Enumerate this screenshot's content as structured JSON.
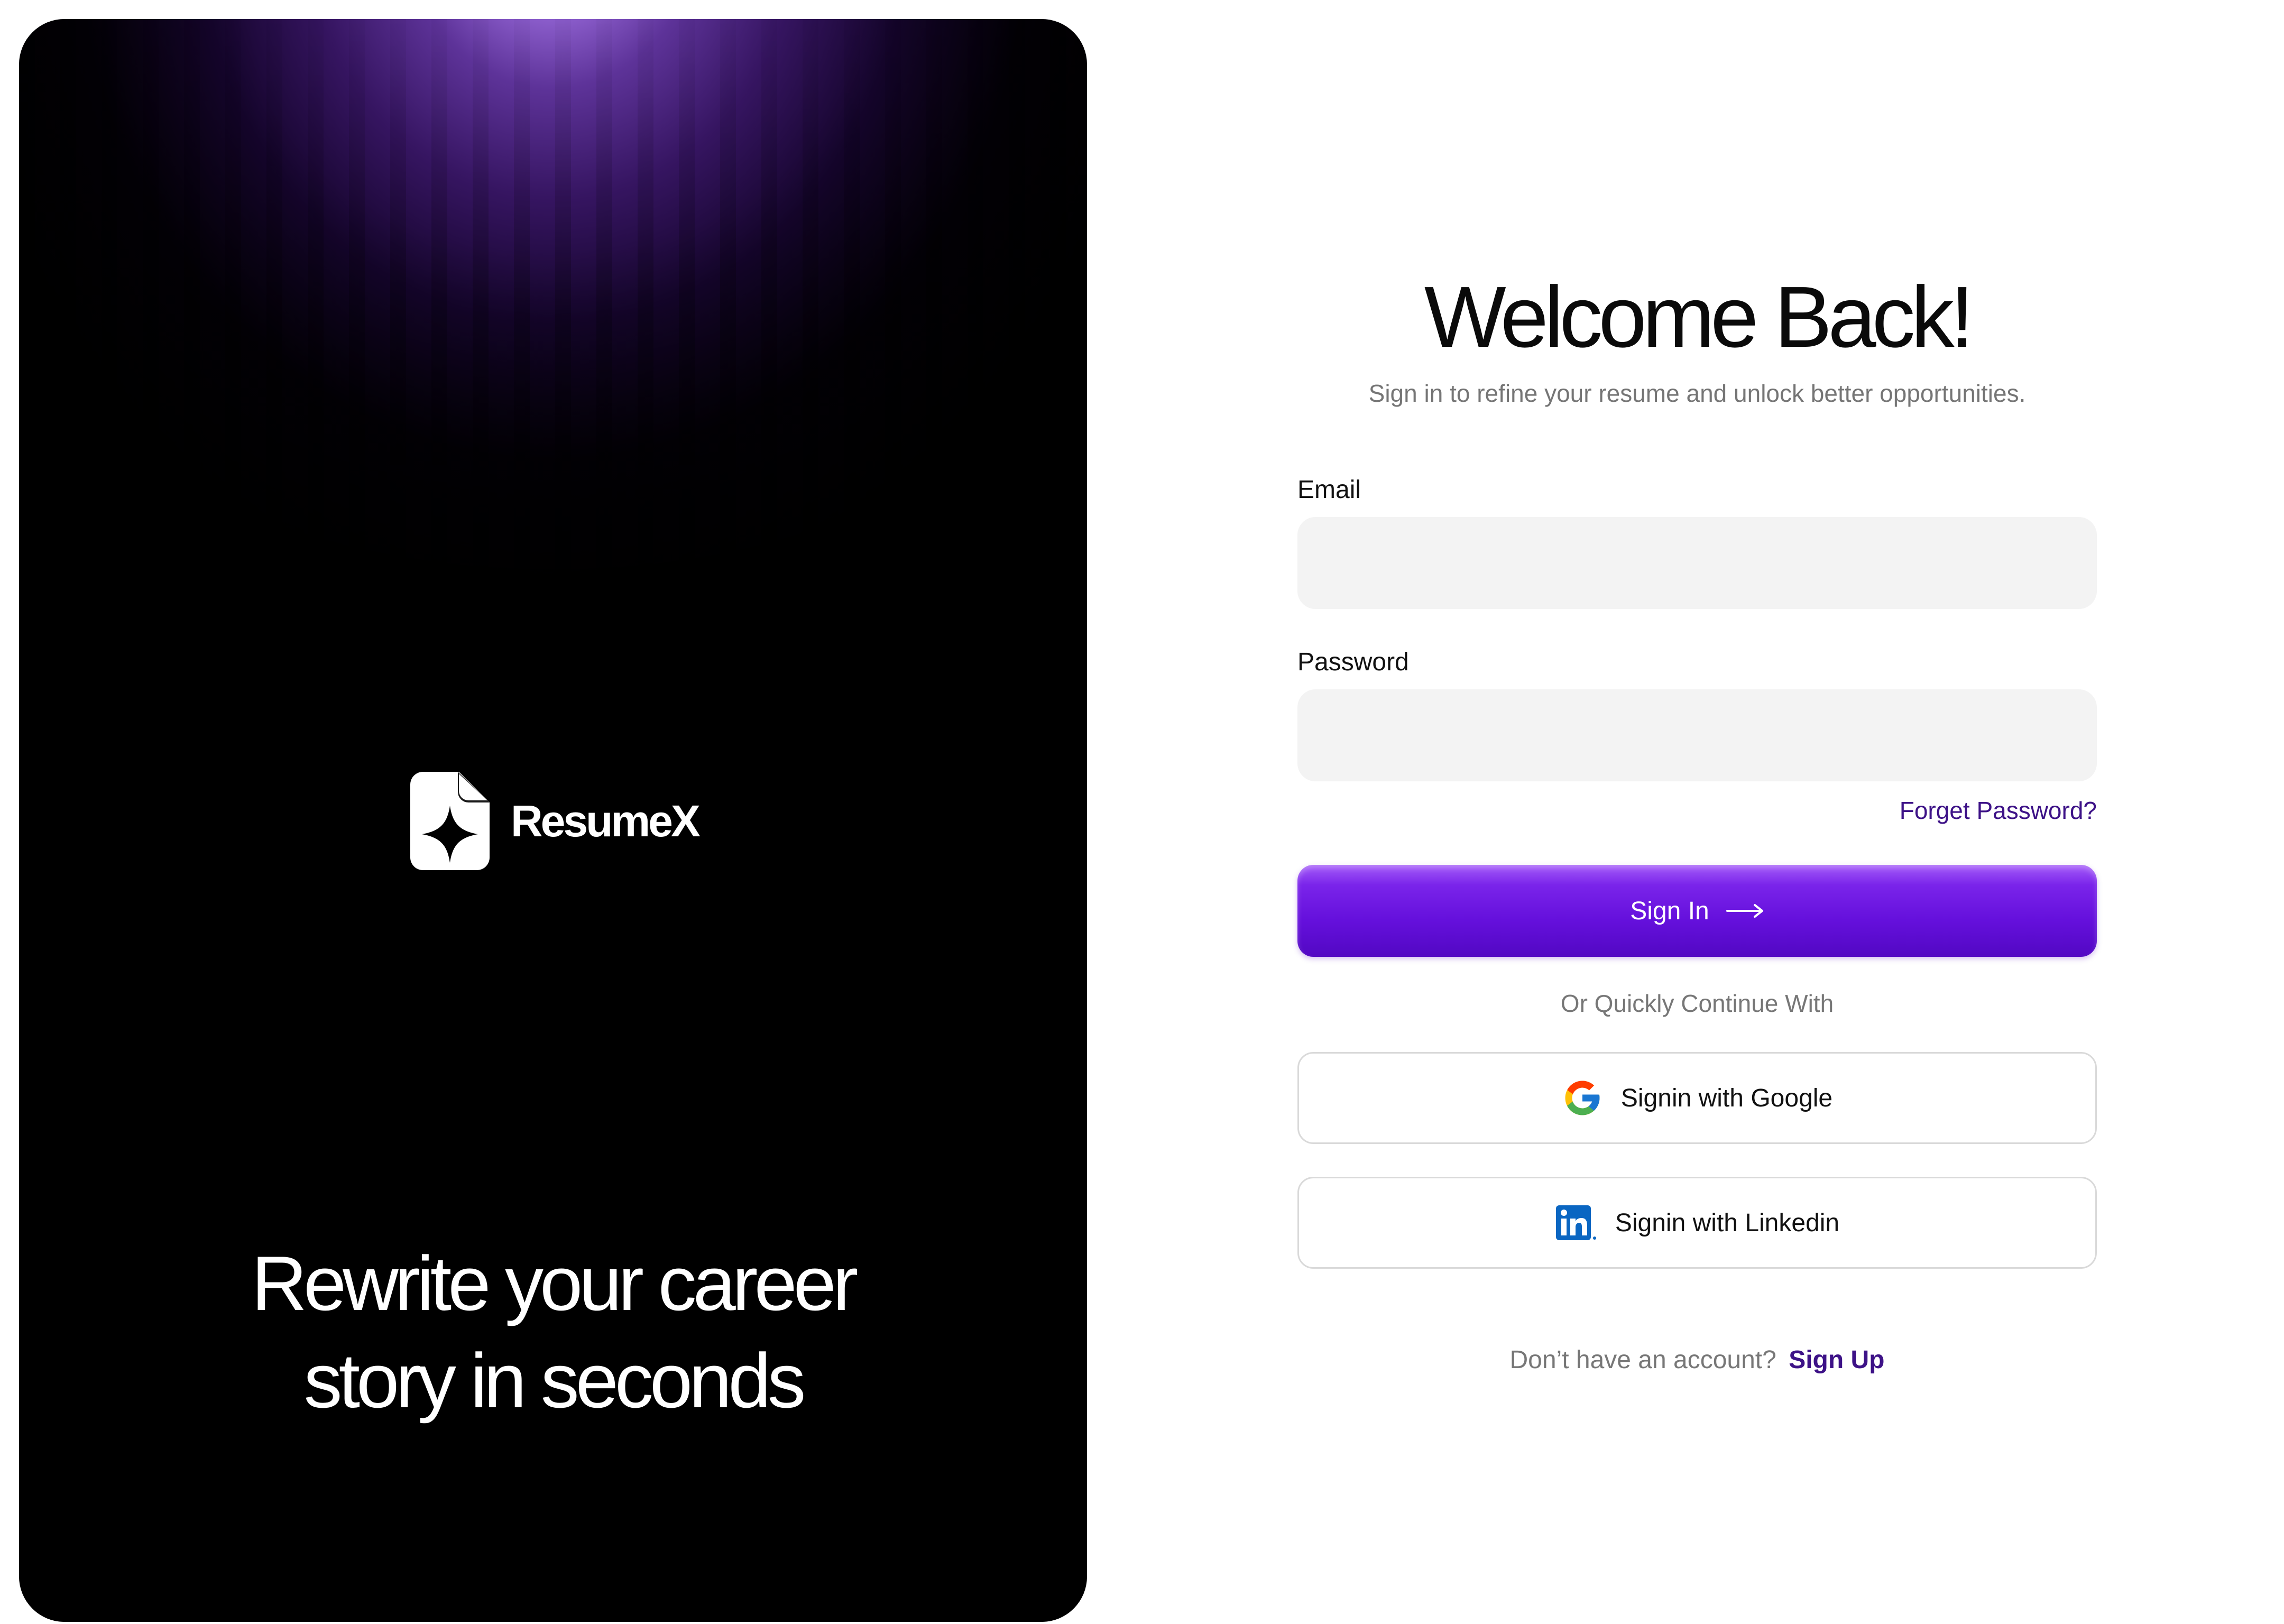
{
  "brand": {
    "name": "ResumeX",
    "tagline_line1": "Rewrite your career",
    "tagline_line2": "story in seconds"
  },
  "form": {
    "title": "Welcome Back!",
    "subtitle": "Sign in to refine your resume and unlock better opportunities.",
    "email_label": "Email",
    "email_value": "",
    "password_label": "Password",
    "password_value": "",
    "forgot_password": "Forget Password?",
    "sign_in_label": "Sign In",
    "or_continue": "Or Quickly Continue With",
    "google_label": "Signin with Google",
    "linkedin_label": "Signin with Linkedin",
    "signup_prompt": "Don’t have an account?",
    "signup_link": "Sign Up"
  },
  "icons": {
    "logo": "document-sparkle-icon",
    "sign_in_arrow": "arrow-right-icon",
    "google": "google-icon",
    "linkedin": "linkedin-icon"
  },
  "colors": {
    "accent": "#6510dc",
    "link": "#3d1287",
    "input_bg": "#f3f3f3",
    "hero_glow": "#d6b0ff"
  }
}
